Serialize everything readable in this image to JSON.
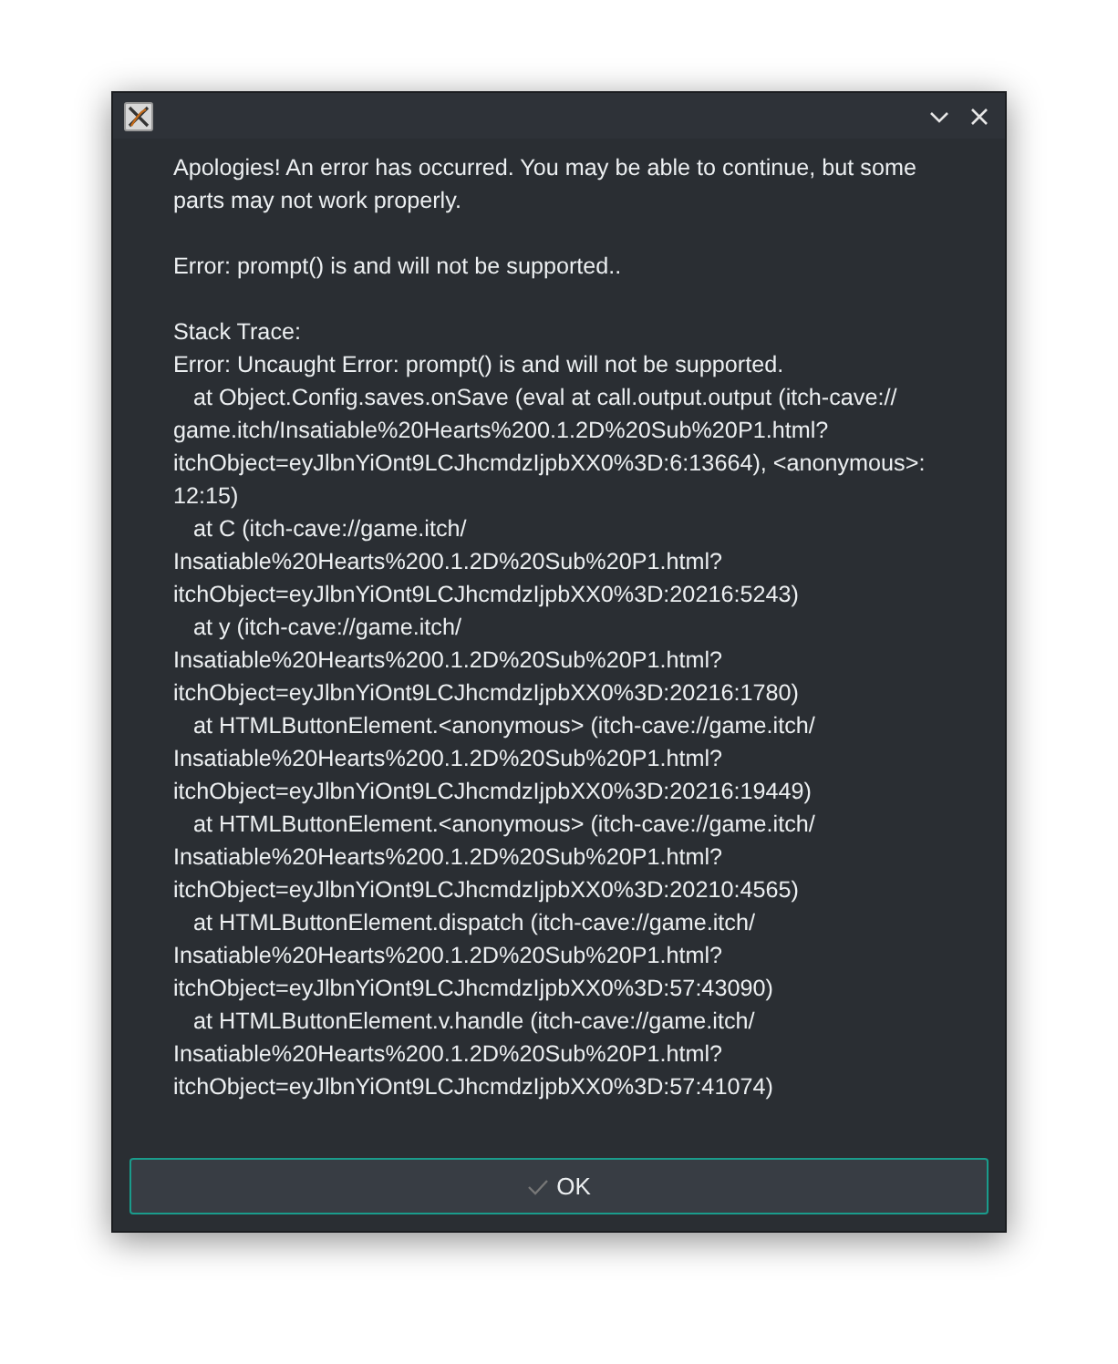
{
  "window": {
    "buttons": [
      {
        "kind": "minimize"
      },
      {
        "kind": "close"
      }
    ]
  },
  "paragraphs": [
    {
      "lines": [
        {
          "text": "Apologies! An error has occurred. You may be able to continue, but some",
          "kind": "plain"
        },
        {
          "text": "parts may not work properly.",
          "kind": "plain"
        }
      ]
    },
    {
      "lines": [
        {
          "text": "Error: prompt() is and will not be supported..",
          "kind": "plain"
        }
      ]
    },
    {
      "lines": [
        {
          "text": "Stack Trace:",
          "kind": "plain"
        },
        {
          "text": "Error: Uncaught Error: prompt() is and will not be supported.",
          "kind": "plain"
        },
        {
          "text": "at Object.Config.saves.onSave (eval at call.output.output (itch-cave://",
          "kind": "frame"
        },
        {
          "text": "game.itch/Insatiable%20Hearts%200.1.2D%20Sub%20P1.html?",
          "kind": "plain"
        },
        {
          "text": "itchObject=eyJlbnYiOnt9LCJhcmdzIjpbXX0%3D:6:13664), <anonymous>:",
          "kind": "plain"
        },
        {
          "text": "12:15)",
          "kind": "plain"
        },
        {
          "text": "at C (itch-cave://game.itch/",
          "kind": "frame"
        },
        {
          "text": "Insatiable%20Hearts%200.1.2D%20Sub%20P1.html?",
          "kind": "plain"
        },
        {
          "text": "itchObject=eyJlbnYiOnt9LCJhcmdzIjpbXX0%3D:20216:5243)",
          "kind": "plain"
        },
        {
          "text": "at y (itch-cave://game.itch/",
          "kind": "frame"
        },
        {
          "text": "Insatiable%20Hearts%200.1.2D%20Sub%20P1.html?",
          "kind": "plain"
        },
        {
          "text": "itchObject=eyJlbnYiOnt9LCJhcmdzIjpbXX0%3D:20216:1780)",
          "kind": "plain"
        },
        {
          "text": "at HTMLButtonElement.<anonymous> (itch-cave://game.itch/",
          "kind": "frame"
        },
        {
          "text": "Insatiable%20Hearts%200.1.2D%20Sub%20P1.html?",
          "kind": "plain"
        },
        {
          "text": "itchObject=eyJlbnYiOnt9LCJhcmdzIjpbXX0%3D:20216:19449)",
          "kind": "plain"
        },
        {
          "text": "at HTMLButtonElement.<anonymous> (itch-cave://game.itch/",
          "kind": "frame"
        },
        {
          "text": "Insatiable%20Hearts%200.1.2D%20Sub%20P1.html?",
          "kind": "plain"
        },
        {
          "text": "itchObject=eyJlbnYiOnt9LCJhcmdzIjpbXX0%3D:20210:4565)",
          "kind": "plain"
        },
        {
          "text": "at HTMLButtonElement.dispatch (itch-cave://game.itch/",
          "kind": "frame"
        },
        {
          "text": "Insatiable%20Hearts%200.1.2D%20Sub%20P1.html?",
          "kind": "plain"
        },
        {
          "text": "itchObject=eyJlbnYiOnt9LCJhcmdzIjpbXX0%3D:57:43090)",
          "kind": "plain"
        },
        {
          "text": "at HTMLButtonElement.v.handle (itch-cave://game.itch/",
          "kind": "frame"
        },
        {
          "text": "Insatiable%20Hearts%200.1.2D%20Sub%20P1.html?",
          "kind": "plain"
        },
        {
          "text": "itchObject=eyJlbnYiOnt9LCJhcmdzIjpbXX0%3D:57:41074)",
          "kind": "plain"
        }
      ]
    }
  ],
  "ok_button": {
    "label": "OK"
  }
}
